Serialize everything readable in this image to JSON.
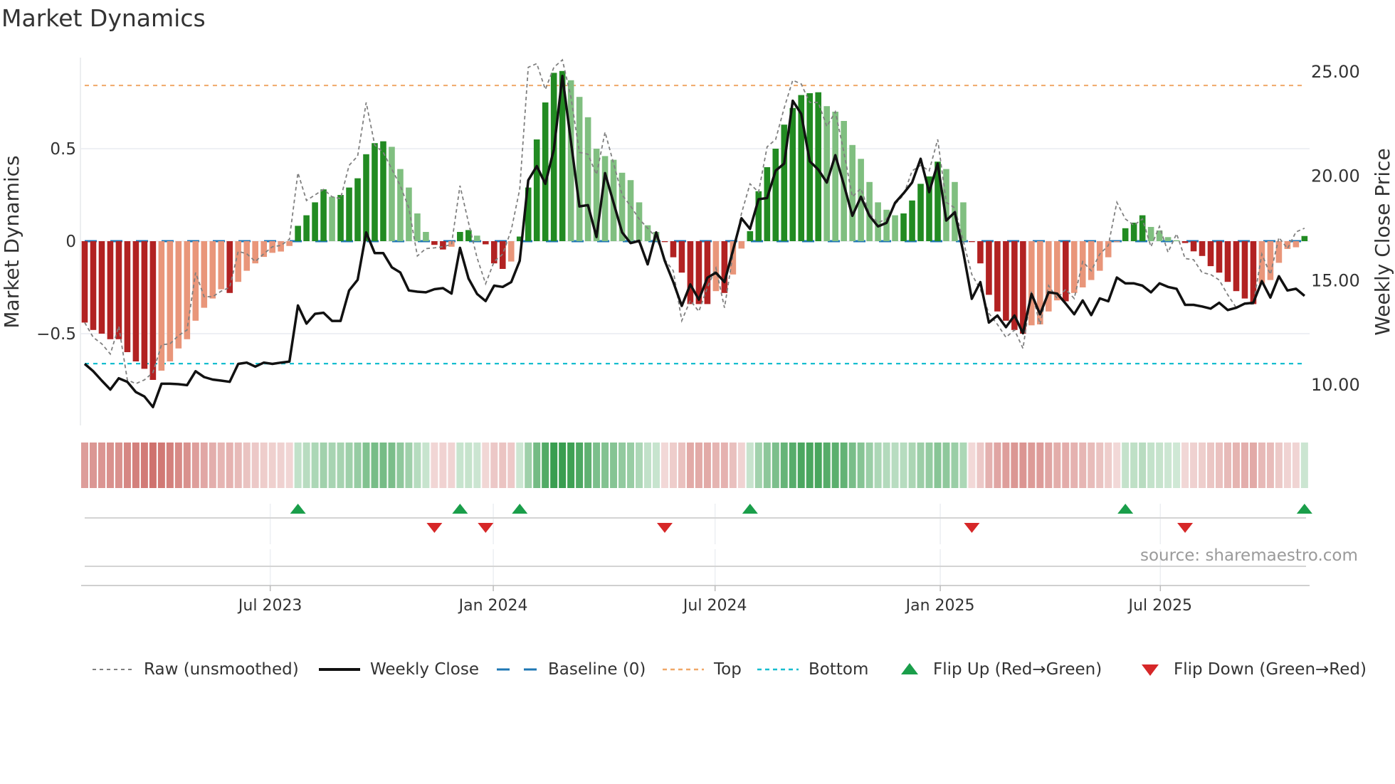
{
  "title": "Market Dynamics",
  "source": "source: sharemaestro.com",
  "legend": {
    "raw": "Raw (unsmoothed)",
    "close": "Weekly Close",
    "baseline": "Baseline (0)",
    "top": "Top",
    "bottom": "Bottom",
    "flip_up": "Flip Up (Red→Green)",
    "flip_down": "Flip Down (Green→Red)"
  },
  "colors": {
    "strong_up": "#228b22",
    "weak_up": "#80bf80",
    "strong_down": "#b22222",
    "weak_down": "#e9967a",
    "baseline": "#1f77b4",
    "top": "#f0a868",
    "bottom": "#17becf",
    "raw": "#808080",
    "close": "#111111",
    "flip_up": "#1a9e4a",
    "flip_down": "#d62728"
  },
  "chart_data": {
    "type": "bar",
    "title": "Market Dynamics",
    "ylabel": "Market Dynamics",
    "y2label": "Weekly Close Price",
    "ylim": [
      -0.93,
      1.0
    ],
    "y2lim": [
      7.0,
      26.0
    ],
    "yticks": [
      {
        "value": 0.5,
        "label": "0.5"
      },
      {
        "value": 0,
        "label": "0"
      },
      {
        "value": -0.5,
        "label": "−0.5"
      }
    ],
    "y2ticks": [
      {
        "value": 25,
        "label": "25.00"
      },
      {
        "value": 20,
        "label": "20.00"
      },
      {
        "value": 15,
        "label": "15.00"
      },
      {
        "value": 10,
        "label": "10.00"
      }
    ],
    "x_ticks": [
      {
        "label": "Jul 2023",
        "week_index": 21.75
      },
      {
        "label": "Jan 2024",
        "week_index": 47.9
      },
      {
        "label": "Jul 2024",
        "week_index": 73.9
      },
      {
        "label": "Jan 2025",
        "week_index": 100.3
      },
      {
        "label": "Jul 2025",
        "week_index": 126.1
      }
    ],
    "top_level": 0.842,
    "bottom_level": -0.662,
    "baseline": 0,
    "momentum": [
      -0.44,
      -0.48,
      -0.5,
      -0.53,
      -0.53,
      -0.6,
      -0.65,
      -0.69,
      -0.75,
      -0.7,
      -0.65,
      -0.58,
      -0.53,
      -0.43,
      -0.36,
      -0.31,
      -0.26,
      -0.28,
      -0.22,
      -0.16,
      -0.12,
      -0.085,
      -0.063,
      -0.056,
      -0.026,
      0.083,
      0.14,
      0.21,
      0.28,
      0.24,
      0.25,
      0.29,
      0.34,
      0.47,
      0.53,
      0.54,
      0.51,
      0.39,
      0.29,
      0.15,
      0.05,
      -0.02,
      -0.045,
      -0.03,
      0.05,
      0.06,
      0.03,
      -0.017,
      -0.12,
      -0.15,
      -0.11,
      0.025,
      0.29,
      0.55,
      0.75,
      0.91,
      0.92,
      0.87,
      0.78,
      0.67,
      0.5,
      0.46,
      0.44,
      0.37,
      0.33,
      0.21,
      0.086,
      0.05,
      -0.005,
      -0.087,
      -0.17,
      -0.34,
      -0.34,
      -0.34,
      -0.27,
      -0.28,
      -0.18,
      -0.04,
      0.054,
      0.27,
      0.4,
      0.5,
      0.63,
      0.72,
      0.79,
      0.8,
      0.805,
      0.73,
      0.7,
      0.65,
      0.52,
      0.445,
      0.32,
      0.21,
      0.17,
      0.14,
      0.15,
      0.22,
      0.31,
      0.35,
      0.43,
      0.39,
      0.32,
      0.21,
      -0.005,
      -0.12,
      -0.29,
      -0.38,
      -0.43,
      -0.48,
      -0.5,
      -0.455,
      -0.45,
      -0.38,
      -0.32,
      -0.325,
      -0.28,
      -0.25,
      -0.21,
      -0.16,
      -0.087,
      -0.005,
      0.07,
      0.1,
      0.14,
      0.077,
      0.058,
      0.022,
      0.005,
      -0.01,
      -0.055,
      -0.08,
      -0.135,
      -0.17,
      -0.22,
      -0.27,
      -0.31,
      -0.34,
      -0.23,
      -0.21,
      -0.117,
      -0.042,
      -0.033,
      0.028
    ],
    "raw": [
      -0.44,
      -0.52,
      -0.555,
      -0.61,
      -0.46,
      -0.75,
      -0.77,
      -0.75,
      -0.71,
      -0.56,
      -0.555,
      -0.51,
      -0.48,
      -0.17,
      -0.3,
      -0.3,
      -0.27,
      -0.25,
      -0.055,
      -0.068,
      -0.11,
      -0.068,
      -0.03,
      -0.023,
      0.01,
      0.37,
      0.22,
      0.25,
      0.28,
      0.24,
      0.23,
      0.41,
      0.46,
      0.75,
      0.52,
      0.48,
      0.39,
      0.3,
      0.18,
      -0.08,
      -0.04,
      -0.036,
      -0.03,
      -0.017,
      0.3,
      0.1,
      -0.09,
      -0.23,
      -0.11,
      -0.07,
      0.06,
      0.28,
      0.94,
      0.96,
      0.82,
      0.94,
      0.98,
      0.78,
      0.48,
      0.47,
      0.36,
      0.59,
      0.42,
      0.25,
      0.19,
      0.12,
      0.07,
      0.02,
      -0.1,
      -0.16,
      -0.43,
      -0.32,
      -0.38,
      -0.25,
      -0.145,
      -0.36,
      -0.07,
      0.15,
      0.31,
      0.265,
      0.51,
      0.55,
      0.72,
      0.87,
      0.85,
      0.75,
      0.75,
      0.62,
      0.7,
      0.48,
      0.24,
      0.285,
      0.15,
      0.1,
      0.12,
      0.2,
      0.25,
      0.38,
      0.41,
      0.38,
      0.55,
      0.21,
      0.18,
      0.0,
      -0.18,
      -0.26,
      -0.39,
      -0.45,
      -0.52,
      -0.48,
      -0.58,
      -0.27,
      -0.45,
      -0.24,
      -0.31,
      -0.26,
      -0.31,
      -0.11,
      -0.16,
      -0.07,
      -0.023,
      0.21,
      0.12,
      0.086,
      0.12,
      -0.03,
      0.08,
      -0.06,
      0.04,
      -0.094,
      -0.1,
      -0.17,
      -0.18,
      -0.21,
      -0.29,
      -0.36,
      -0.34,
      -0.34,
      -0.07,
      -0.18,
      0.02,
      -0.04,
      0.05,
      0.07
    ],
    "weekly_close": [
      10.97,
      10.62,
      10.17,
      9.74,
      10.28,
      10.11,
      9.62,
      9.41,
      8.9,
      10.02,
      10.02,
      10.0,
      9.95,
      10.62,
      10.34,
      10.22,
      10.17,
      10.11,
      10.97,
      11.03,
      10.84,
      11.03,
      10.97,
      11.03,
      11.08,
      13.77,
      12.9,
      13.37,
      13.42,
      13.03,
      13.03,
      14.49,
      15.0,
      17.27,
      16.28,
      16.28,
      15.6,
      15.35,
      14.49,
      14.43,
      14.4,
      14.55,
      14.6,
      14.34,
      16.53,
      15.06,
      14.32,
      13.98,
      14.72,
      14.66,
      14.89,
      15.91,
      19.77,
      20.45,
      19.6,
      21.25,
      24.77,
      21.65,
      18.52,
      18.58,
      17.05,
      20.11,
      18.69,
      17.27,
      16.76,
      16.87,
      15.74,
      17.27,
      15.91,
      14.89,
      13.75,
      14.78,
      14.05,
      15.1,
      15.34,
      14.89,
      16.42,
      17.95,
      17.44,
      18.86,
      18.92,
      20.23,
      20.57,
      23.58,
      22.95,
      20.68,
      20.28,
      19.66,
      20.97,
      19.55,
      18.07,
      18.98,
      18.07,
      17.56,
      17.73,
      18.69,
      19.15,
      19.66,
      20.8,
      19.2,
      20.57,
      17.84,
      18.24,
      16.31,
      14.09,
      14.89,
      12.95,
      13.29,
      12.73,
      13.29,
      12.44,
      14.32,
      13.35,
      14.4,
      14.34,
      13.86,
      13.35,
      14.01,
      13.31,
      14.11,
      13.97,
      15.11,
      14.83,
      14.83,
      14.72,
      14.4,
      14.83,
      14.66,
      14.57,
      13.8,
      13.8,
      13.72,
      13.62,
      13.9,
      13.55,
      13.66,
      13.86,
      13.9,
      14.94,
      14.15,
      15.17,
      14.49,
      14.57,
      14.23
    ],
    "flip_up_weeks": [
      26,
      45,
      52,
      79,
      123,
      144
    ],
    "flip_down_weeks": [
      42,
      48,
      69,
      105,
      130
    ]
  }
}
